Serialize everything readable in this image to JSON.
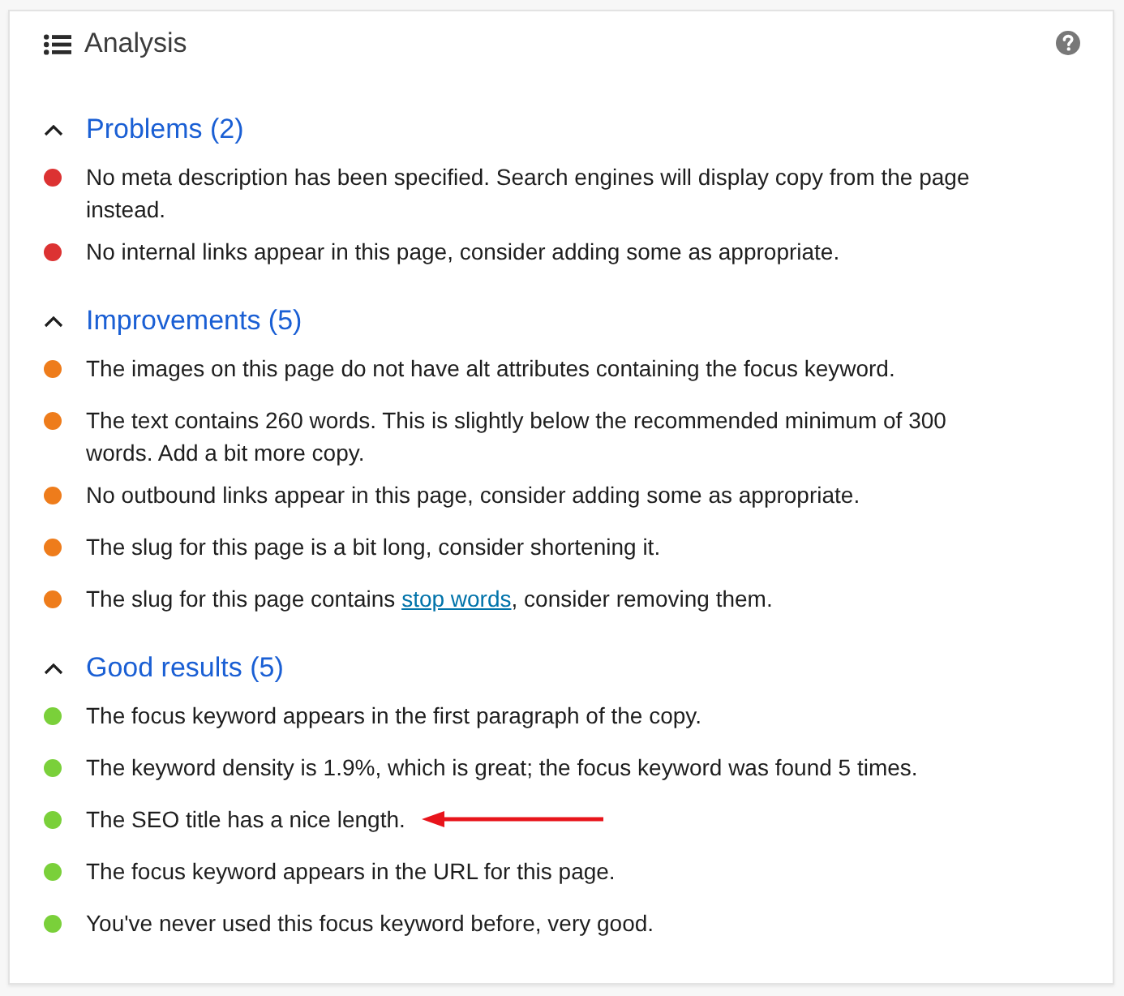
{
  "panel": {
    "title": "Analysis"
  },
  "sections": [
    {
      "heading": "Problems (2)",
      "expanded": true,
      "items": [
        {
          "text": "No meta description has been specified. Search engines will display copy from the page instead.",
          "color": "#dc3232",
          "arrow": false
        },
        {
          "text": "No internal links appear in this page, consider adding some as appropriate.",
          "color": "#dc3232",
          "arrow": false
        }
      ]
    },
    {
      "heading": "Improvements (5)",
      "expanded": true,
      "items": [
        {
          "text": "The images on this page do not have alt attributes containing the focus keyword.",
          "color": "#ee7c1b",
          "arrow": false
        },
        {
          "text": "The text contains 260 words. This is slightly below the recommended minimum of 300 words. Add a bit more copy.",
          "color": "#ee7c1b",
          "arrow": false
        },
        {
          "text": "No outbound links appear in this page, consider adding some as appropriate.",
          "color": "#ee7c1b",
          "arrow": false
        },
        {
          "text": "The slug for this page is a bit long, consider shortening it.",
          "color": "#ee7c1b",
          "arrow": false
        },
        {
          "parts": [
            {
              "kind": "text",
              "text": "The slug for this page contains "
            },
            {
              "kind": "link",
              "text": "stop words"
            },
            {
              "kind": "text",
              "text": ", consider removing them."
            }
          ],
          "color": "#ee7c1b",
          "arrow": false
        }
      ]
    },
    {
      "heading": "Good results (5)",
      "expanded": true,
      "items": [
        {
          "text": "The focus keyword appears in the first paragraph of the copy.",
          "color": "#7ad03a",
          "arrow": false
        },
        {
          "text": "The keyword density is 1.9%, which is great; the focus keyword was found 5 times.",
          "color": "#7ad03a",
          "arrow": false
        },
        {
          "text": "The SEO title has a nice length.",
          "color": "#7ad03a",
          "arrow": true
        },
        {
          "text": "The focus keyword appears in the URL for this page.",
          "color": "#7ad03a",
          "arrow": false
        },
        {
          "text": "You've never used this focus keyword before, very good.",
          "color": "#7ad03a",
          "arrow": false
        }
      ]
    }
  ]
}
